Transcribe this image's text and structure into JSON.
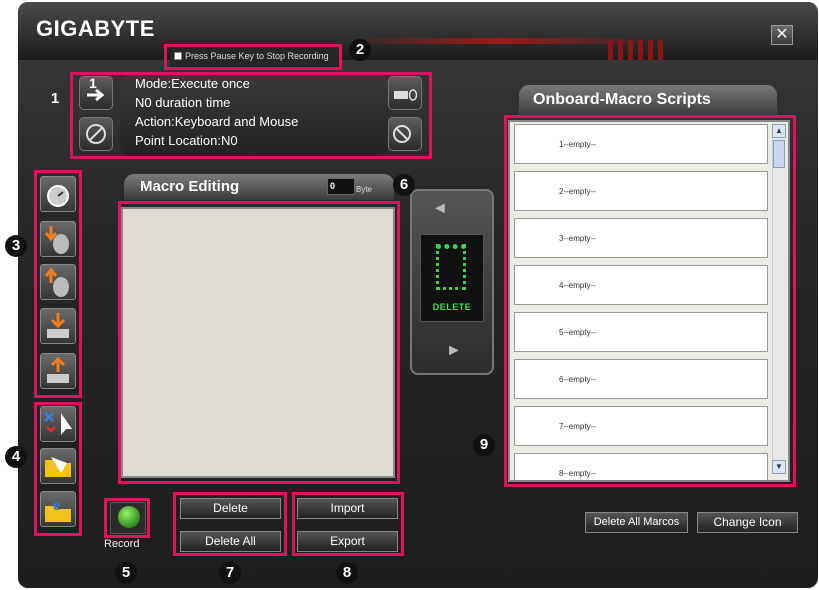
{
  "window": {
    "brand": "GIGABYTE",
    "close_glyph": "✕"
  },
  "recording": {
    "pause_key_label": "Press Pause Key to Stop Recording",
    "checked": false
  },
  "status": {
    "mode": "Mode:Execute once",
    "duration": "N0 duration time",
    "action": "Action:Keyboard and Mouse",
    "point_location": "Point Location:N0"
  },
  "info_buttons": {
    "top_left": {
      "label": "1",
      "icon": "arrow-right-icon"
    },
    "bottom_left": {
      "icon": "compass-icon"
    },
    "top_right": {
      "icon": "keyboard-mouse-icon"
    },
    "bottom_right": {
      "icon": "no-sync-icon"
    }
  },
  "macro_editing": {
    "title": "Macro Editing",
    "byte_value": "0",
    "byte_label": "Byte"
  },
  "side_tools": [
    {
      "icon": "timer-icon"
    },
    {
      "icon": "mouse-down-icon"
    },
    {
      "icon": "mouse-up-icon"
    },
    {
      "icon": "key-down-icon"
    },
    {
      "icon": "key-up-icon"
    }
  ],
  "file_tools": [
    {
      "icon": "cursor-remove-icon"
    },
    {
      "icon": "folder-open-icon"
    },
    {
      "icon": "browser-folder-icon"
    }
  ],
  "delete_zone": {
    "label": "DELETE"
  },
  "onboard": {
    "title": "Onboard-Macro Scripts",
    "slots": [
      "1--empty--",
      "2--empty--",
      "3--empty--",
      "4--empty--",
      "5--empty--",
      "6--empty--",
      "7--empty--",
      "8--empty--"
    ]
  },
  "buttons": {
    "delete": "Delete",
    "delete_all": "Delete All",
    "import": "Import",
    "export": "Export",
    "delete_all_macros": "Delete All Marcos",
    "change_icon": "Change Icon",
    "record": "Record"
  },
  "callout_numbers": [
    "1",
    "2",
    "3",
    "4",
    "5",
    "6",
    "7",
    "8",
    "9"
  ],
  "colors": {
    "callout": "#e0115f",
    "led_green": "#44e04f"
  }
}
